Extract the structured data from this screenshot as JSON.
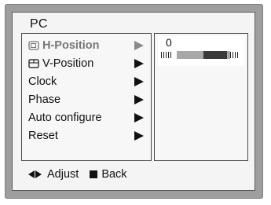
{
  "osd": {
    "title": "PC",
    "menu": [
      {
        "label": "H-Position",
        "icon": "h-position-icon",
        "selected": true
      },
      {
        "label": "V-Position",
        "icon": "v-position-icon",
        "selected": false
      },
      {
        "label": "Clock",
        "selected": false
      },
      {
        "label": "Phase",
        "selected": false
      },
      {
        "label": "Auto configure",
        "selected": false
      },
      {
        "label": "Reset",
        "selected": false
      }
    ],
    "value_panel": {
      "value": "0",
      "slider_fraction": 0.5
    },
    "hints": {
      "adjust_label": "Adjust",
      "back_label": "Back"
    }
  }
}
